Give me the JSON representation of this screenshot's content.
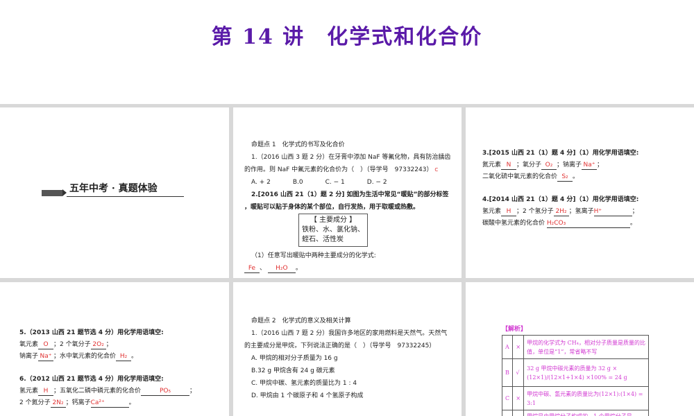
{
  "title": "第 14 讲　化学式和化合价",
  "section_heading": "五年中考 · 真题体验",
  "p2": {
    "topic": "命题点 1　化学式的书写及化合价",
    "q1a": "1.（2016 山西 3 题 2 分）在牙膏中添加 NaF 等氟化物，具有防治龋齿",
    "q1b": "的作用。则 NaF 中氟元素的化合价为（　）（导学号　97332243）",
    "q1_mark": "C",
    "options": [
      "A. + 2",
      "B.0",
      "C. − 1",
      "D. − 2"
    ],
    "q2a": "2.[2016 山西 21（1）题 2 分] 如图为生活中常见“暖贴”的部分标签",
    "q2b": "，暖贴可以贴于身体的某个部位，自行发热，用于取暖或热敷。",
    "box_title": "【 主要成分 】",
    "box_l1": "铁粉、水、氯化钠、",
    "box_l2": "蛭石、活性炭",
    "q2_sub": "（1）任意写出暖贴中两种主要成分的化学式:",
    "ans1": "Fe",
    "ans2": "H₂O"
  },
  "p3": {
    "q3": "3.[2015 山西 21（1）题 4 分]（1）用化学用语填空:",
    "l1a": "氮元素",
    "a1": "N",
    "l1b": "；氧分子",
    "a2": "O₂",
    "l1c": "；钠离子",
    "a3": "Na⁺",
    "l2": "二氧化硫中氧元素的化合价",
    "a4": "S₂",
    "q4": "4.[2014 山西 21（1）题 4 分]（1）用化学用语填空:",
    "l3a": "氢元素",
    "b1": "H",
    "l3b": "；2 个氢分子",
    "b2": "2H₂",
    "l3c": "；氢离子",
    "b3": "H⁺",
    "l4": "碳酸中氢元素的化合价",
    "b4": "H₂CO₃"
  },
  "p4": {
    "q5": "5.（2013 山西 21 题节选 4 分）用化学用语填空:",
    "l1a": "氧元素",
    "a1": "O",
    "l1b": "；2 个氧分子",
    "a2": "2O₂",
    "l2a": "钠离子",
    "a3": "Na⁺",
    "l2b": "；水中氧元素的化合价",
    "a4": "H₂",
    "q6": "6.（2012 山西 21 题节选 4 分）用化学用语填空:",
    "l3a": "氢元素",
    "b1": "H",
    "l3b": "；五氧化二磷中磷元素的化合价",
    "b2": "PO₅",
    "l4a": "2 个氮分子",
    "b3": "2N₂",
    "l4b": "；钙离子",
    "b4": "Ca²⁺"
  },
  "p5": {
    "topic": "命题点 2　化学式的意义及相关计算",
    "q1a": "1.（2016 山西 7 题 2 分）我国许多地区的家用燃料是天然气。天然气",
    "q1b": "的主要成分是甲烷，下列说法正确的是（　）（导学号　97332245）",
    "options": [
      "A. 甲烷的相对分子质量为 16 g",
      "B.32 g 甲烷含有 24 g 碳元素",
      "C. 甲烷中碳、氢元素的质量比为 1 : 4",
      "D. 甲烷由 1 个碳原子和 4 个氢原子构成"
    ]
  },
  "p6": {
    "heading": "【解析】",
    "rows": [
      {
        "opt": "A",
        "mark": "×",
        "text": "甲烷的化学式为 CH₄，相对分子质量是质量的比值，单位是“1”，常省略不写"
      },
      {
        "opt": "B",
        "mark": "√",
        "text": "32 g 甲烷中碳元素的质量为 32 g × (12×1)/(12×1+1×4) ×100% = 24 g"
      },
      {
        "opt": "C",
        "mark": "×",
        "text": "甲烷中碳、氢元素的质量比为(12×1):(1×4) = 3:1"
      },
      {
        "opt": "D",
        "mark": "×",
        "text": "甲烷是由甲烷分子构成的，1 个甲烷分子是"
      }
    ]
  }
}
